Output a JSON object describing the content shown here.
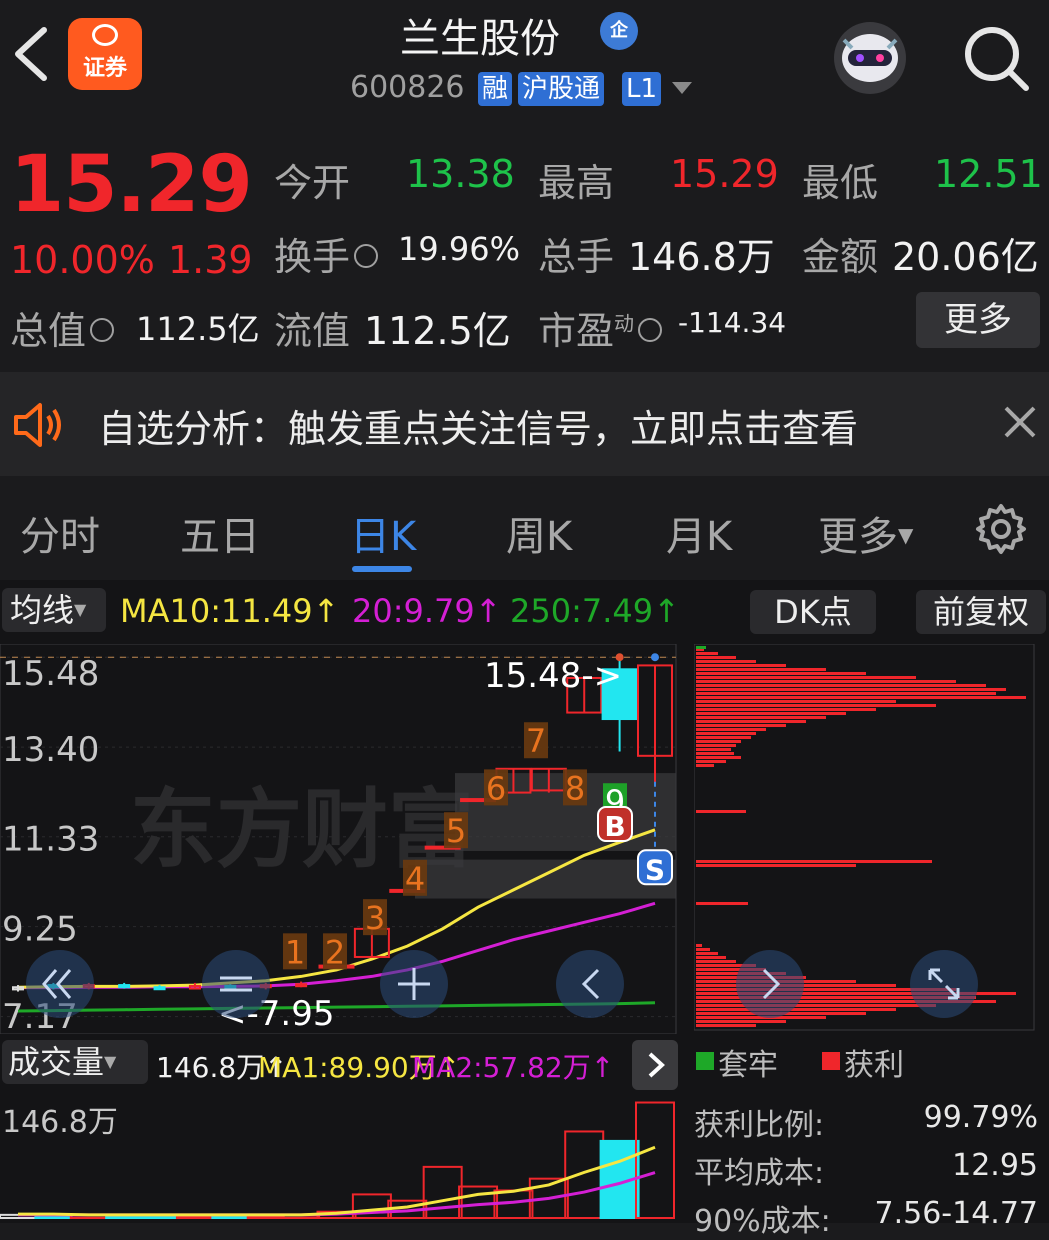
{
  "header": {
    "app_badge": "证券",
    "title": "兰生股份",
    "enterprise_badge": "企",
    "code": "600826",
    "tags": [
      "融",
      "沪股通",
      "L1"
    ]
  },
  "quote": {
    "price": "15.29",
    "change_pct": "10.00%",
    "change": "1.39",
    "open_label": "今开",
    "open": "13.38",
    "high_label": "最高",
    "high": "15.29",
    "low_label": "最低",
    "low": "12.51",
    "turnover_label": "换手",
    "turnover": "19.96%",
    "volume_label": "总手",
    "volume": "146.8万",
    "amount_label": "金额",
    "amount": "20.06亿",
    "mktcap_label": "总值",
    "mktcap": "112.5亿",
    "float_label": "流值",
    "float_cap": "112.5亿",
    "pe_label": "市盈",
    "pe_sup": "动",
    "pe": "-114.34",
    "more_button": "更多"
  },
  "notice": {
    "text": "自选分析：触发重点关注信号，立即点击查看"
  },
  "tabs": [
    "分时",
    "五日",
    "日K",
    "周K",
    "月K",
    "更多"
  ],
  "active_tab": "日K",
  "ma_bar": {
    "selector": "均线",
    "ma10": "MA10:11.49",
    "ma20": "20:9.79",
    "ma250": "250:7.49",
    "dk_button": "DK点",
    "adjust_button": "前复权"
  },
  "kline": {
    "price_labels": [
      "15.48",
      "13.40",
      "11.33",
      "9.25",
      "7.17"
    ],
    "high_marker": "15.48->",
    "low_marker": "<-7.95",
    "counts": [
      "1",
      "2",
      "3",
      "4",
      "5",
      "6",
      "7",
      "8",
      "9"
    ],
    "buy_mark": "B",
    "sell_mark": "S",
    "watermark": "东方财富"
  },
  "volume_bar": {
    "selector": "成交量",
    "vol": "146.8万",
    "ma1": "MA1:89.90万",
    "ma2": "MA2:57.82万",
    "axis_label": "146.8万"
  },
  "profile_legend": {
    "trapped": "套牢",
    "profit": "获利"
  },
  "cost_stats": [
    {
      "label": "获利比例:",
      "value": "99.79%"
    },
    {
      "label": "平均成本:",
      "value": "12.95"
    },
    {
      "label": "90%成本:",
      "value": "7.56-14.77"
    }
  ],
  "colors": {
    "up": "#f0262b",
    "down": "#1ec24a",
    "accent": "#3d86e6",
    "ma10": "#f5e642",
    "ma20": "#d41fd4",
    "ma250": "#1ea828",
    "cyan": "#22e6f0",
    "count_tag": "#e8731f"
  },
  "chart_data": {
    "type": "candlestick",
    "price_axis_ticks": [
      15.48,
      13.4,
      11.33,
      9.25,
      7.17
    ],
    "candles": [
      {
        "o": 7.8,
        "c": 7.85,
        "h": 7.9,
        "l": 7.75,
        "dir": "flat"
      },
      {
        "o": 7.9,
        "c": 7.85,
        "h": 7.95,
        "l": 7.8,
        "dir": "down"
      },
      {
        "o": 7.85,
        "c": 7.9,
        "h": 7.95,
        "l": 7.8,
        "dir": "up"
      },
      {
        "o": 7.9,
        "c": 7.85,
        "h": 7.95,
        "l": 7.82,
        "dir": "down"
      },
      {
        "o": 7.85,
        "c": 7.82,
        "h": 7.9,
        "l": 7.8,
        "dir": "down"
      },
      {
        "o": 7.82,
        "c": 7.88,
        "h": 7.95,
        "l": 7.8,
        "dir": "up"
      },
      {
        "o": 7.88,
        "c": 7.85,
        "h": 7.92,
        "l": 7.82,
        "dir": "down"
      },
      {
        "o": 7.85,
        "c": 7.9,
        "h": 7.95,
        "l": 7.8,
        "dir": "up"
      },
      {
        "o": 7.9,
        "c": 7.92,
        "h": 7.98,
        "l": 7.85,
        "dir": "up"
      },
      {
        "o": 8.35,
        "c": 8.35,
        "h": 8.35,
        "l": 8.35,
        "dir": "up"
      },
      {
        "o": 8.55,
        "c": 9.2,
        "h": 9.2,
        "l": 8.55,
        "dir": "up"
      },
      {
        "o": 10.1,
        "c": 10.1,
        "h": 10.1,
        "l": 10.1,
        "dir": "up"
      },
      {
        "o": 11.1,
        "c": 11.1,
        "h": 11.1,
        "l": 11.1,
        "dir": "up"
      },
      {
        "o": 12.2,
        "c": 12.2,
        "h": 12.2,
        "l": 12.2,
        "dir": "up"
      },
      {
        "o": 12.35,
        "c": 12.9,
        "h": 12.9,
        "l": 12.35,
        "dir": "up"
      },
      {
        "o": 12.4,
        "c": 12.9,
        "h": 12.9,
        "l": 12.35,
        "dir": "up"
      },
      {
        "o": 14.2,
        "c": 15.0,
        "h": 15.0,
        "l": 14.2,
        "dir": "up"
      },
      {
        "o": 15.2,
        "c": 14.05,
        "h": 15.48,
        "l": 13.3,
        "dir": "down"
      },
      {
        "o": 13.2,
        "c": 15.29,
        "h": 15.29,
        "l": 12.51,
        "dir": "up"
      }
    ],
    "ma10": [
      7.85,
      7.86,
      7.87,
      7.87,
      7.88,
      7.9,
      7.95,
      8.0,
      8.1,
      8.25,
      8.5,
      8.8,
      9.2,
      9.7,
      10.1,
      10.5,
      10.9,
      11.2,
      11.49
    ],
    "ma20": [
      7.84,
      7.84,
      7.85,
      7.85,
      7.86,
      7.86,
      7.87,
      7.88,
      7.92,
      8.0,
      8.1,
      8.25,
      8.45,
      8.7,
      8.95,
      9.15,
      9.35,
      9.55,
      9.79
    ],
    "ma250": [
      7.3,
      7.31,
      7.32,
      7.33,
      7.34,
      7.35,
      7.36,
      7.37,
      7.38,
      7.39,
      7.4,
      7.41,
      7.42,
      7.43,
      7.44,
      7.45,
      7.46,
      7.47,
      7.49
    ],
    "volume": {
      "max_label": "146.8万",
      "bars": [
        4,
        3,
        3,
        2,
        3,
        2,
        3,
        2,
        3,
        8,
        30,
        22,
        65,
        40,
        35,
        50,
        110,
        98,
        146.8
      ],
      "dir": [
        "flat",
        "down",
        "up",
        "down",
        "down",
        "up",
        "down",
        "up",
        "up",
        "up",
        "up",
        "up",
        "up",
        "up",
        "up",
        "up",
        "up",
        "down",
        "up"
      ],
      "ma1": [
        5,
        5,
        4,
        4,
        4,
        4,
        4,
        4,
        4,
        6,
        10,
        14,
        22,
        30,
        34,
        42,
        58,
        72,
        89.9
      ],
      "ma2": [
        4,
        4,
        4,
        4,
        4,
        4,
        4,
        4,
        4,
        5,
        7,
        9,
        13,
        17,
        20,
        25,
        33,
        44,
        57.82
      ]
    }
  }
}
